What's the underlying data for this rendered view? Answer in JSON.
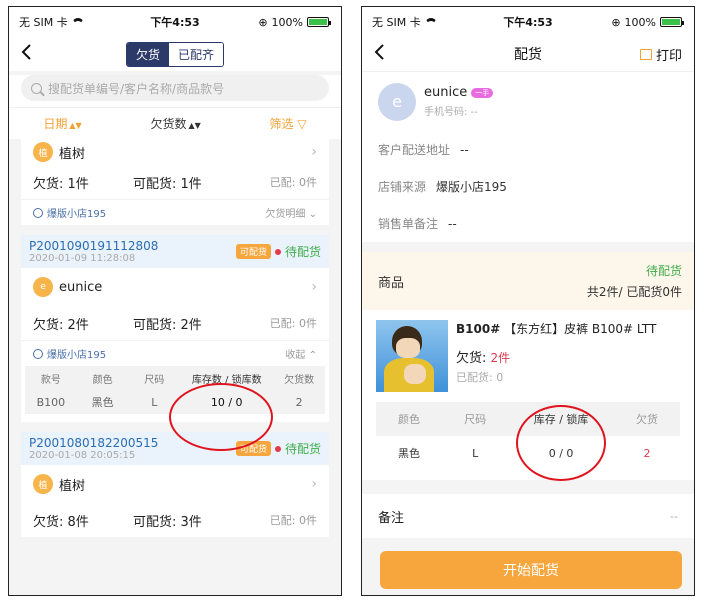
{
  "status": {
    "carrier": "无 SIM 卡",
    "time": "下午4:53",
    "battery": "100%"
  },
  "left": {
    "tabs": {
      "active": "欠货",
      "inactive": "已配齐"
    },
    "search_placeholder": "搜配货单编号/客户名称/商品款号",
    "filters": {
      "date": "日期",
      "qty": "欠货数",
      "filter": "筛选"
    },
    "top_card": {
      "customer": "植树",
      "avatar": "植",
      "owe": "欠货: 1件",
      "available": "可配货: 1件",
      "done": "已配: 0件",
      "store": "爆版小店195",
      "detail": "欠货明细"
    },
    "card1": {
      "order_no": "P2001090191112808",
      "date": "2020-01-09 11:28:08",
      "tag": "可配货",
      "status": "待配货",
      "customer": "eunice",
      "avatar": "e",
      "owe": "欠货: 2件",
      "available": "可配货: 2件",
      "done": "已配: 0件",
      "store": "爆版小店195",
      "collapse": "收起",
      "table_headers": {
        "code": "款号",
        "color": "颜色",
        "size": "尺码",
        "stock": "库存数 / 锁库数",
        "owe": "欠货数"
      },
      "row": {
        "code": "B100",
        "color": "黑色",
        "size": "L",
        "stock": "10 / 0",
        "owe": "2"
      }
    },
    "card2": {
      "order_no": "P2001080182200515",
      "date": "2020-01-08 20:05:15",
      "tag": "可配货",
      "status": "待配货",
      "customer": "植树",
      "avatar": "植",
      "owe": "欠货: 8件",
      "available": "可配货: 3件",
      "done": "已配: 0件"
    }
  },
  "right": {
    "title": "配货",
    "print": "打印",
    "customer": {
      "name": "eunice",
      "avatar": "e",
      "badge": "一手",
      "phone": "手机号码: --"
    },
    "address": {
      "label": "客户配送地址",
      "value": "--"
    },
    "store": {
      "label": "店铺来源",
      "value": "爆版小店195"
    },
    "remark": {
      "label": "销售单备注",
      "value": "--"
    },
    "goods": {
      "label": "商品",
      "status": "待配货",
      "summary": "共2件/ 已配货0件"
    },
    "product": {
      "title_code": "B100#",
      "title_rest": "【东方红】皮裤 B100# LTT",
      "owe_label": "欠货:",
      "owe_value": "2件",
      "done": "已配货: 0"
    },
    "table_headers": {
      "color": "颜色",
      "size": "尺码",
      "stock": "库存 / 锁库",
      "owe": "欠货"
    },
    "row": {
      "color": "黑色",
      "size": "L",
      "stock": "0 / 0",
      "owe": "2"
    },
    "note": {
      "label": "备注",
      "value": "--"
    },
    "button": "开始配货"
  }
}
